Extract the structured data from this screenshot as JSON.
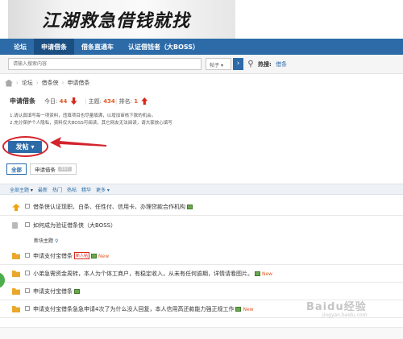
{
  "banner": {
    "title": "江湖救急借钱就找"
  },
  "nav": {
    "items": [
      "论坛",
      "申请借条",
      "借条直通车",
      "认证借钱者（大BOSS）"
    ],
    "active_index": 1
  },
  "search": {
    "placeholder": "请输入搜索内容",
    "type": "帖子",
    "hot_label": "热搜:",
    "hot_term": "借条"
  },
  "breadcrumb": [
    "论坛",
    "借条侠",
    "申请借条"
  ],
  "forum": {
    "title": "申请借条",
    "today_label": "今日:",
    "today": "44",
    "topics_label": "主题:",
    "topics": "434",
    "rank_label": "排名:",
    "rank": "1",
    "notice1": "1.请认真填写每一项资料，违填项目也尽量填满，以增加审核下款的机会。",
    "notice2": "2.充分保护个人隐私，资料仅大BOSS可阅读，其它网友无法阅读，请大家放心填写"
  },
  "post_button": "发帖",
  "tabs": [
    {
      "label": "全部"
    },
    {
      "label": "申请借条",
      "count": "397"
    }
  ],
  "filters": [
    "全部主题",
    "最新",
    "热门",
    "热帖",
    "精华",
    "更多"
  ],
  "pinned": [
    {
      "text": "借条侠认证现职、白条、任性付、信用卡、办理贷款合作机构"
    },
    {
      "text": "如何成为验证借条侠（大BOSS）"
    }
  ],
  "section_label": "新块主题",
  "threads": [
    {
      "text": "申请支付宝借条",
      "tag": "新人帖",
      "new": "New"
    },
    {
      "text": "小弟急需资金周转，本人为个体工商户，有稳定收入，从未有任何逾期，详情请看图片。",
      "new": "New"
    },
    {
      "text": "申请支付宝借条"
    },
    {
      "text": "申请支付宝借条急急申请4次了为什么没人回复，本人信用高还款能力强正规工作",
      "new": "New"
    }
  ],
  "watermark": {
    "main": "Baidu经验",
    "sub": "jingyan.baidu.com"
  }
}
